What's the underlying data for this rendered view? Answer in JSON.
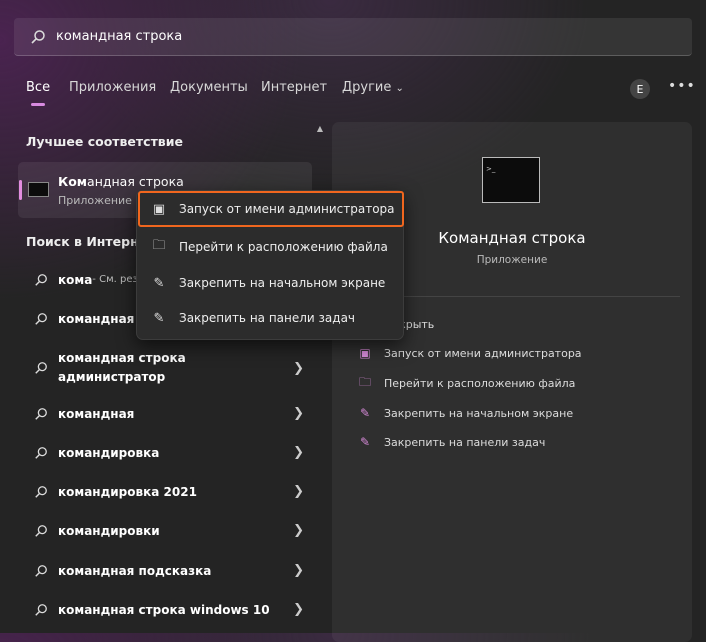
{
  "search": {
    "value": "командная строка"
  },
  "tabs": [
    {
      "label": "Все",
      "active": true
    },
    {
      "label": "Приложения"
    },
    {
      "label": "Документы"
    },
    {
      "label": "Интернет"
    },
    {
      "label": "Другие"
    }
  ],
  "user_initial": "E",
  "more": "•••",
  "best_match": {
    "heading": "Лучшее соответствие",
    "title_bold": "Ком",
    "title_rest": "андная строка",
    "subtitle": "Приложение"
  },
  "web": {
    "heading": "Поиск в Интернете",
    "items": [
      {
        "bold": "кома",
        "rest": " - См. результаты в Интернете"
      },
      {
        "bold": "командная строка",
        "rest": ""
      },
      {
        "bold": "командная строка администратор",
        "rest": ""
      },
      {
        "bold": "командная",
        "rest": ""
      },
      {
        "bold": "командировка",
        "rest": ""
      },
      {
        "bold": "командировка 2021",
        "rest": ""
      },
      {
        "bold": "командировки",
        "rest": ""
      },
      {
        "bold": "командная подсказка",
        "rest": ""
      },
      {
        "bold": "командная строка windows 10",
        "rest": ""
      }
    ]
  },
  "context_menu": [
    {
      "label": "Запуск от имени администратора",
      "icon": "shield-window-icon"
    },
    {
      "label": "Перейти к расположению файла",
      "icon": "folder-icon"
    },
    {
      "label": "Закрепить на начальном экране",
      "icon": "pin-icon"
    },
    {
      "label": "Закрепить на панели задач",
      "icon": "pin-icon"
    }
  ],
  "detail": {
    "title": "Командная строка",
    "subtitle": "Приложение",
    "actions": [
      {
        "label": "Открыть"
      },
      {
        "label": "Запуск от имени администратора"
      },
      {
        "label": "Перейти к расположению файла"
      },
      {
        "label": "Закрепить на начальном экране"
      },
      {
        "label": "Закрепить на панели задач"
      }
    ]
  },
  "colors": {
    "accent": "#d88ae0",
    "highlight": "#f0661e"
  }
}
